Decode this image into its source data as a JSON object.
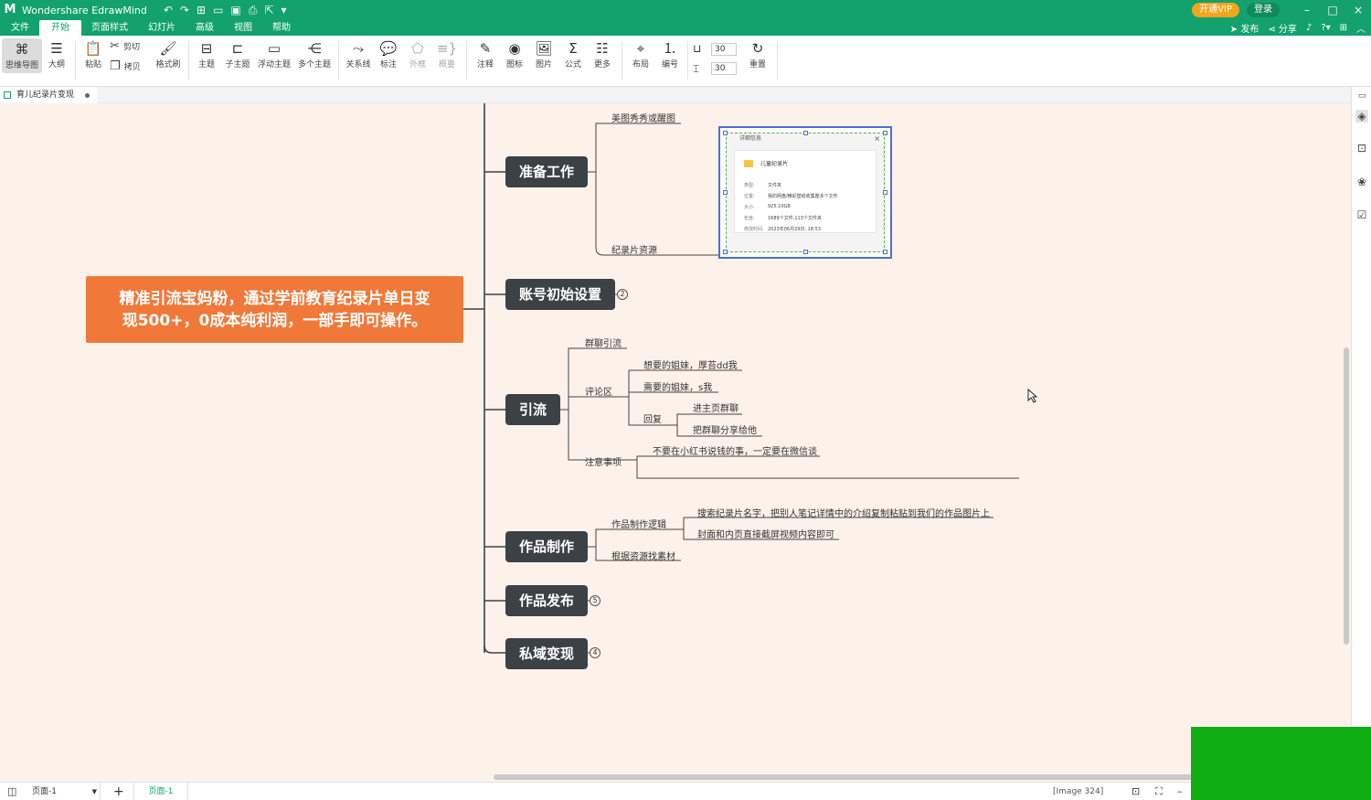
{
  "titlebar": {
    "app_name": "Wondershare EdrawMind",
    "vip": "开通VIP",
    "login": "登录",
    "win": [
      "–",
      "□",
      "×"
    ]
  },
  "menu": {
    "items": [
      "文件",
      "开始",
      "页面样式",
      "幻灯片",
      "高级",
      "视图",
      "帮助"
    ],
    "active": "开始",
    "publish": "发布",
    "share": "分享"
  },
  "ribbon": {
    "tools": [
      "思维导图",
      "大纲",
      "粘贴",
      "剪切",
      "拷贝",
      "格式刷",
      "主题",
      "子主题",
      "浮动主题",
      "多个主题",
      "关系线",
      "标注",
      "外框",
      "概要",
      "注释",
      "图标",
      "图片",
      "公式",
      "更多",
      "布局",
      "编号",
      "重置"
    ],
    "spin_width": "30",
    "spin_height": "30"
  },
  "document": {
    "tab_name": "育儿纪录片变现"
  },
  "mindmap": {
    "central": [
      "精准引流宝妈粉，通过学前教育纪录片单日变",
      "现500+，0成本纯利润，一部手即可操作。"
    ],
    "branches": {
      "prep": "准备工作",
      "account": "账号初始设置",
      "traffic": "引流",
      "production": "作品制作",
      "publish": "作品发布",
      "private": "私域变现"
    },
    "badges": {
      "account": "2",
      "publish": "5",
      "private": "4"
    },
    "leaves": {
      "meitu": "美图秀秀或醒图",
      "resource": "纪录片资源",
      "group": "群聊引流",
      "comment": "评论区",
      "c1": "想要的姐妹，厚苔dd我",
      "c2": "需要的姐妹，s我",
      "reply": "回复",
      "r1": "进主页群聊",
      "r2": "把群聊分享给他",
      "notice": "注意事项",
      "n1": "不要在小红书说钱的事，一定要在微信谈",
      "logic": "作品制作逻辑",
      "l1": "搜索纪录片名字，把别人笔记详情中的介绍复制粘贴到我们的作品图片上",
      "l2": "封面和内页直接截屏视频内容即可",
      "material": "根据资源找素材"
    }
  },
  "embedded": {
    "header": "详细信息",
    "folder_name": "儿童纪录片",
    "rows": [
      {
        "k": "类型:",
        "v": "文件夹"
      },
      {
        "k": "位置:",
        "v": "我的网盘/精彩壁纸收集整多个文件"
      },
      {
        "k": "大小:",
        "v": "925.10GB"
      },
      {
        "k": "包含:",
        "v": "1689个文件,113个文件夹"
      },
      {
        "k": "修改时间:",
        "v": "2023年06月29日, 18:53"
      }
    ]
  },
  "status": {
    "page_select": "页面-1",
    "page_tab": "页面-1",
    "image_info": "[Image 324]"
  },
  "colors": {
    "brand": "#13a26e",
    "central": "#f0793a",
    "branch": "#3c4146",
    "canvas": "#fdf2ea"
  }
}
